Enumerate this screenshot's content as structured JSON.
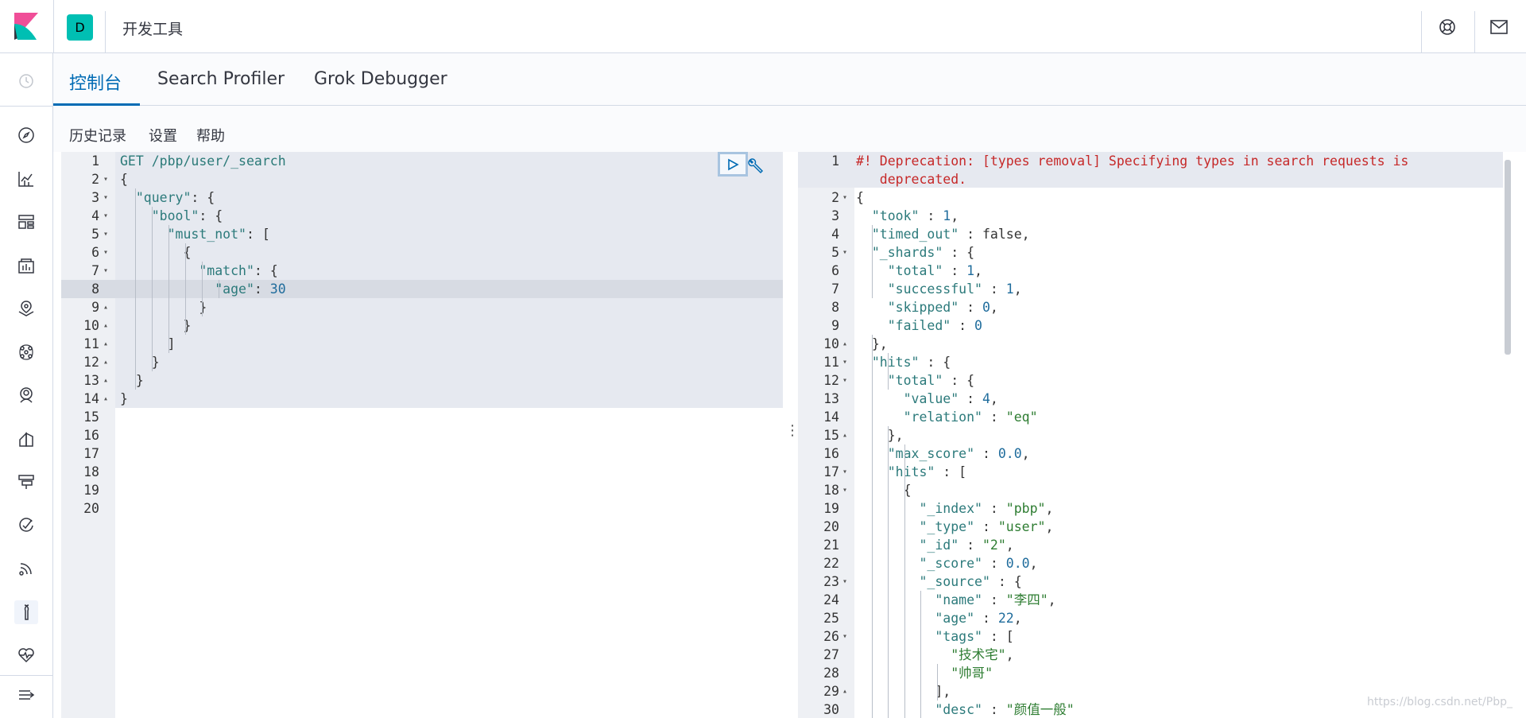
{
  "header": {
    "space_initial": "D",
    "app_title": "开发工具"
  },
  "tabs": [
    {
      "label": "控制台",
      "selected": true
    },
    {
      "label": "Search Profiler",
      "selected": false
    },
    {
      "label": "Grok Debugger",
      "selected": false
    }
  ],
  "subnav": [
    "历史记录",
    "设置",
    "帮助"
  ],
  "request": {
    "method": "GET",
    "path": "/pbp/user/_search",
    "line_numbers": [
      "1",
      "2",
      "3",
      "4",
      "5",
      "6",
      "7",
      "8",
      "9",
      "10",
      "11",
      "12",
      "13",
      "14",
      "15",
      "16",
      "17",
      "18",
      "19",
      "20"
    ],
    "lines": [
      "GET /pbp/user/_search",
      "{",
      "  \"query\": {",
      "    \"bool\": {",
      "      \"must_not\": [",
      "        {",
      "          \"match\": {",
      "            \"age\": 30",
      "          }",
      "        }",
      "      ]",
      "    }",
      "  }",
      "}"
    ]
  },
  "response": {
    "line_numbers": [
      "1",
      "",
      "2",
      "3",
      "4",
      "5",
      "6",
      "7",
      "8",
      "9",
      "10",
      "11",
      "12",
      "13",
      "14",
      "15",
      "16",
      "17",
      "18",
      "19",
      "20",
      "21",
      "22",
      "23",
      "24",
      "25",
      "26",
      "27",
      "28",
      "29",
      "30"
    ],
    "lines": [
      "#! Deprecation: [types removal] Specifying types in search requests is",
      "   deprecated.",
      "{",
      "  \"took\" : 1,",
      "  \"timed_out\" : false,",
      "  \"_shards\" : {",
      "    \"total\" : 1,",
      "    \"successful\" : 1,",
      "    \"skipped\" : 0,",
      "    \"failed\" : 0",
      "  },",
      "  \"hits\" : {",
      "    \"total\" : {",
      "      \"value\" : 4,",
      "      \"relation\" : \"eq\"",
      "    },",
      "    \"max_score\" : 0.0,",
      "    \"hits\" : [",
      "      {",
      "        \"_index\" : \"pbp\",",
      "        \"_type\" : \"user\",",
      "        \"_id\" : \"2\",",
      "        \"_score\" : 0.0,",
      "        \"_source\" : {",
      "          \"name\" : \"李四\",",
      "          \"age\" : 22,",
      "          \"tags\" : [",
      "            \"技术宅\",",
      "            \"帅哥\"",
      "          ],",
      "          \"desc\" : \"颜值一般\""
    ]
  },
  "watermark": "https://blog.csdn.net/Pbp_",
  "colors": {
    "accent": "#006bb4",
    "space_avatar": "#00bfb3",
    "deprecation": "#c62828"
  },
  "icons": {
    "header": [
      "help-lifebuoy-icon",
      "mail-icon"
    ],
    "sidenav": [
      "clock-icon",
      "compass-icon",
      "visualize-icon",
      "dashboard-icon",
      "canvas-icon",
      "maps-icon",
      "ml-icon",
      "apm-icon",
      "infra-icon",
      "uptime-icon",
      "siem-icon",
      "logs-icon",
      "dev-tools-icon",
      "monitoring-icon",
      "collapse-menu-icon"
    ]
  }
}
